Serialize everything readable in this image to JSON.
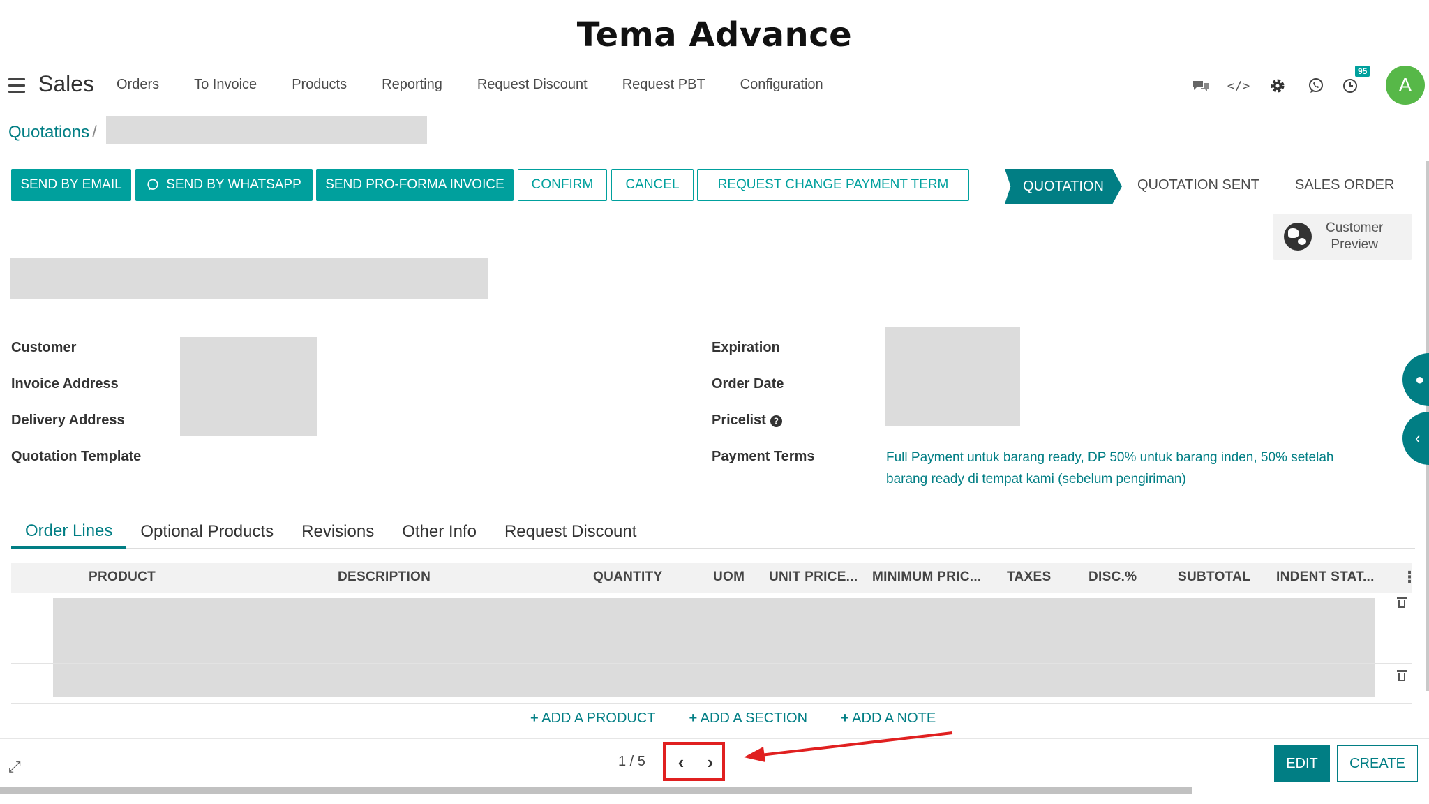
{
  "page_heading": "Tema Advance",
  "navbar": {
    "app_name": "Sales",
    "menu": [
      "Orders",
      "To Invoice",
      "Products",
      "Reporting",
      "Request Discount",
      "Request PBT",
      "Configuration"
    ],
    "icons": [
      "chat-icon",
      "code-icon",
      "gear-icon",
      "whatsapp-icon",
      "activity-icon"
    ],
    "activity_badge": "95",
    "avatar_letter": "A"
  },
  "breadcrumb": {
    "root": "Quotations",
    "separator": "/"
  },
  "actions": {
    "send_email": "SEND BY EMAIL",
    "send_whatsapp": "SEND BY WHATSAPP",
    "send_proforma": "SEND PRO-FORMA INVOICE",
    "confirm": "CONFIRM",
    "cancel": "CANCEL",
    "request_change": "REQUEST CHANGE PAYMENT TERM"
  },
  "status": {
    "active": "QUOTATION",
    "steps": [
      "QUOTATION SENT",
      "SALES ORDER"
    ]
  },
  "preview": {
    "line1": "Customer",
    "line2": "Preview"
  },
  "fields": {
    "customer": "Customer",
    "invoice_address": "Invoice Address",
    "delivery_address": "Delivery Address",
    "quotation_template": "Quotation Template",
    "expiration": "Expiration",
    "order_date": "Order Date",
    "pricelist": "Pricelist",
    "payment_terms_label": "Payment Terms",
    "payment_terms_value_line1": "Full Payment untuk barang ready, DP 50% untuk barang inden, 50% setelah",
    "payment_terms_value_line2": "barang ready di tempat kami (sebelum pengiriman)"
  },
  "tabs": [
    "Order Lines",
    "Optional Products",
    "Revisions",
    "Other Info",
    "Request Discount"
  ],
  "table": {
    "columns": [
      "PRODUCT",
      "DESCRIPTION",
      "QUANTITY",
      "UOM",
      "UNIT PRICE...",
      "MINIMUM PRIC...",
      "TAXES",
      "DISC.%",
      "SUBTOTAL",
      "INDENT STAT..."
    ]
  },
  "add_links": {
    "product": "ADD A PRODUCT",
    "section": "ADD A SECTION",
    "note": "ADD A NOTE"
  },
  "pager": {
    "text": "1 / 5"
  },
  "footer": {
    "edit": "EDIT",
    "create": "CREATE"
  },
  "colors": {
    "primary": "#017e84",
    "button": "#00a09d",
    "annotation": "#e02020",
    "avatar": "#57b848"
  }
}
